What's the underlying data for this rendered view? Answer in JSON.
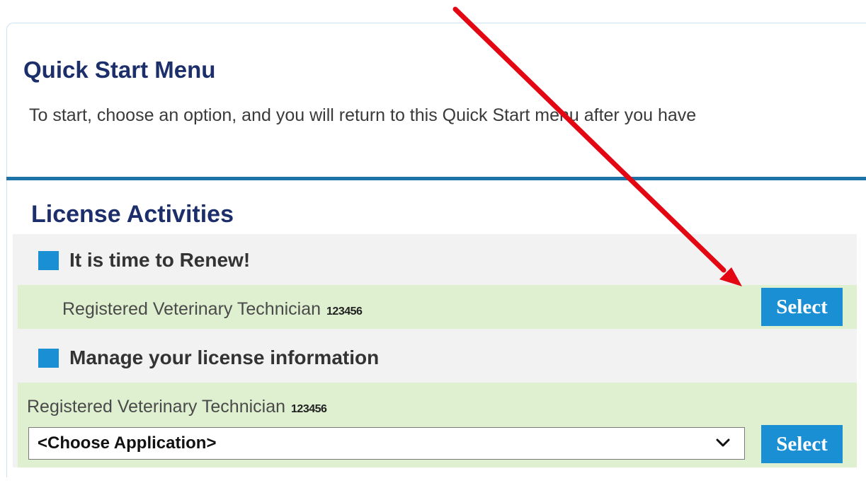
{
  "quick_start": {
    "title": "Quick Start Menu",
    "description": "To start, choose an option, and you will return to this Quick Start menu after you have"
  },
  "license_activities": {
    "title": "License Activities",
    "renew": {
      "heading": "It is time to Renew!",
      "license_name": "Registered Veterinary Technician",
      "license_number": "123456",
      "button_label": "Select"
    },
    "manage": {
      "heading": "Manage your license information",
      "license_name": "Registered Veterinary Technician",
      "license_number": "123456",
      "dropdown_selected": "<Choose Application>",
      "button_label": "Select"
    }
  },
  "colors": {
    "heading_navy": "#1d2f6a",
    "accent_blue": "#1b8fd4",
    "divider_blue": "#1d72a8",
    "row_green": "#dff0d0",
    "annotation_arrow": "#e30613"
  },
  "icons": [
    "square-bullet-icon",
    "chevron-down-icon",
    "annotation-arrow"
  ]
}
